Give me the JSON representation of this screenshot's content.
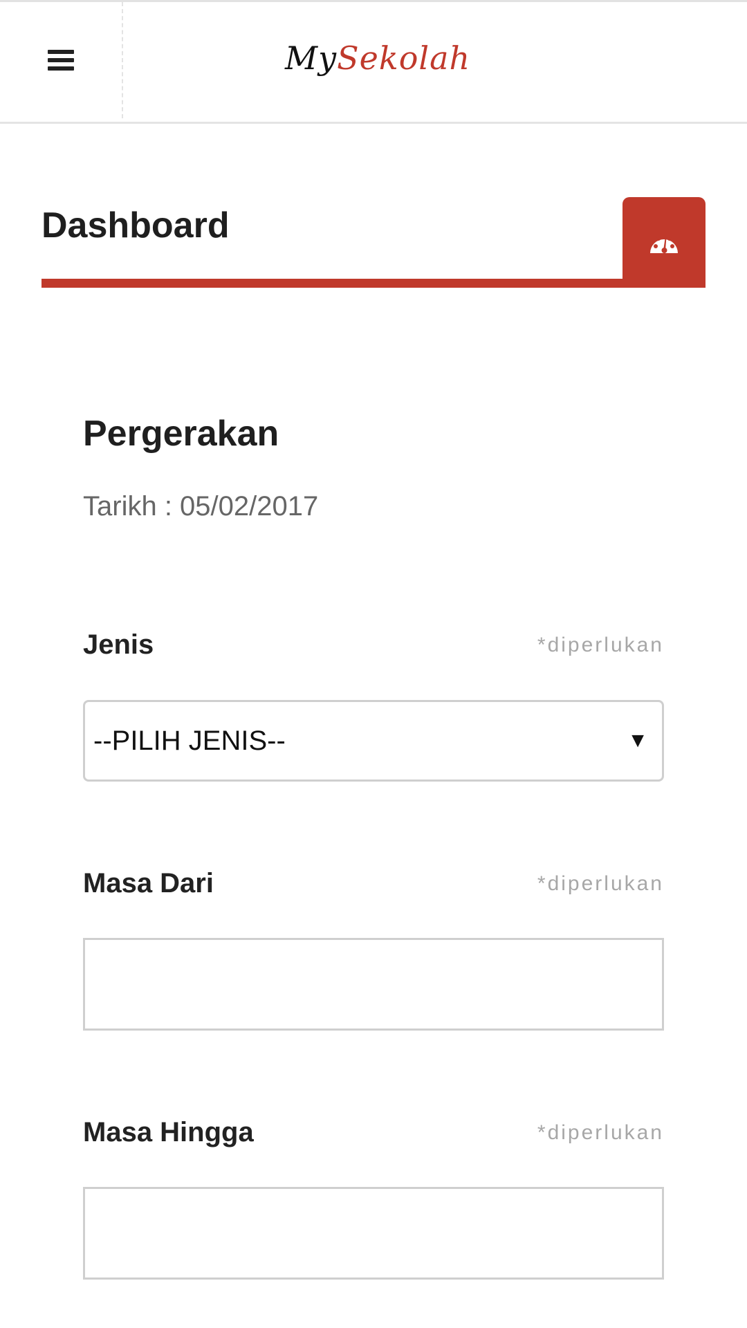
{
  "header": {
    "logo_my": "My",
    "logo_sekolah": "Sekolah",
    "menu_icon": "hamburger-menu-icon"
  },
  "dashboard": {
    "title": "Dashboard",
    "badge_icon": "dashboard-gauge-icon",
    "accent_color": "#c0392b"
  },
  "form": {
    "title": "Pergerakan",
    "date_text": "Tarikh : 05/02/2017",
    "required_text": "*diperlukan",
    "fields": [
      {
        "label": "Jenis",
        "type": "select",
        "value": "--PILIH JENIS--"
      },
      {
        "label": "Masa Dari",
        "type": "text",
        "value": ""
      },
      {
        "label": "Masa Hingga",
        "type": "text",
        "value": ""
      }
    ]
  }
}
